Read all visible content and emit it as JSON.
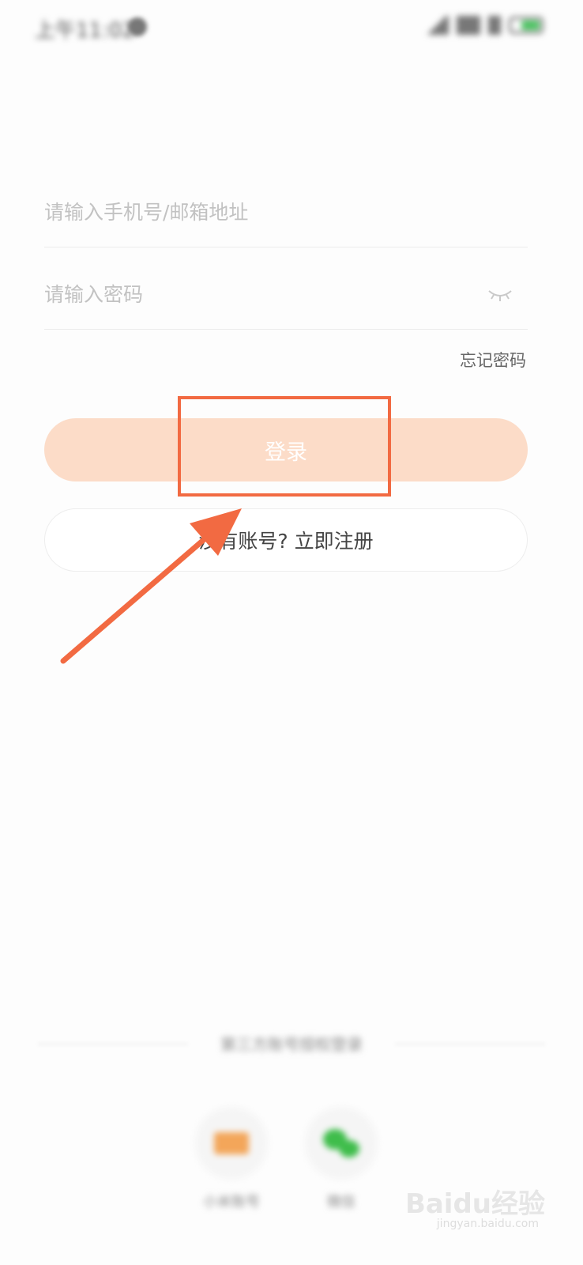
{
  "status_bar": {
    "time": "上午11:02"
  },
  "form": {
    "phone_placeholder": "请输入手机号/邮箱地址",
    "password_placeholder": "请输入密码",
    "forgot_password": "忘记密码",
    "login_label": "登录",
    "register_label": "没有账号? 立即注册"
  },
  "third_party": {
    "title": "第三方账号授权登录",
    "items": [
      {
        "label": "小米账号",
        "icon": "mi-icon"
      },
      {
        "label": "微信",
        "icon": "wechat-icon"
      }
    ]
  },
  "watermark": {
    "text": "Baidu经验",
    "sub": "jingyan.baidu.com"
  },
  "colors": {
    "accent": "#f26a42",
    "login_bg": "#fcdcc8",
    "wechat": "#3fbd4b"
  }
}
